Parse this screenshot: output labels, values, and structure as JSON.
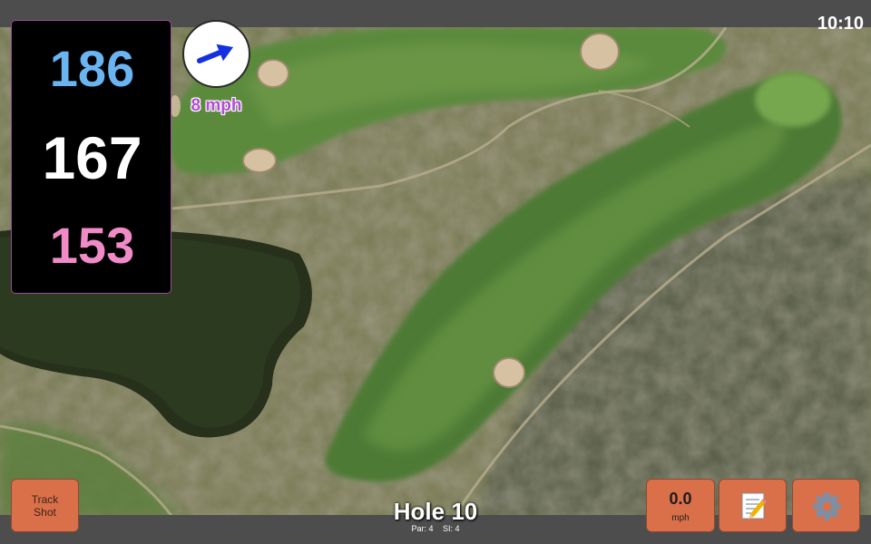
{
  "status_bar": {
    "time": "10:10"
  },
  "yardages": {
    "back": "186",
    "center": "167",
    "front": "153",
    "colors": {
      "back": "#6ab4f2",
      "center": "#ffffff",
      "front": "#f08bc8"
    }
  },
  "wind": {
    "speed_label": "8 mph",
    "arrow_color": "#1430e0",
    "icon": "wind-direction-arrow-icon"
  },
  "buttons": {
    "track_shot_line1": "Track",
    "track_shot_line2": "Shot",
    "speed_value": "0.0",
    "speed_unit": "mph",
    "notes_icon": "memo-icon",
    "settings_icon": "gear-icon"
  },
  "hole": {
    "title": "Hole 10",
    "par": "Par: 4",
    "si": "SI: 4"
  },
  "colors": {
    "button": "#d9704a",
    "panel": "#000000",
    "bar": "#4d4d4d"
  }
}
